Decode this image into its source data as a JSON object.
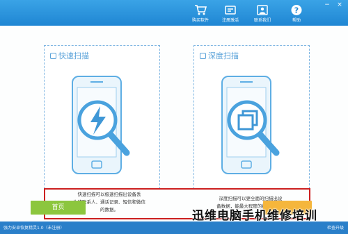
{
  "window": {
    "minimize": "−",
    "close": "×"
  },
  "toolbar": {
    "items": [
      {
        "label": "购买软件",
        "icon": "cart-icon"
      },
      {
        "label": "注册激活",
        "icon": "key-icon"
      },
      {
        "label": "联系我们",
        "icon": "contact-icon"
      },
      {
        "label": "帮助",
        "icon": "help-icon"
      }
    ]
  },
  "panels": {
    "quick": {
      "title": "快速扫描",
      "icon": "lightning-icon",
      "description_line1": "快速扫描可以极速扫描出设备丢",
      "description_line2": "失的联系人、通话记录、短信和微信",
      "description_line3": "的数据。"
    },
    "deep": {
      "title": "深度扫描",
      "icon": "layers-icon",
      "description_line1": "深度扫描可以更全面的扫描出设",
      "description_line2": "备数据，能最大程度的找回文件。"
    }
  },
  "buttons": {
    "home": "首页",
    "next": ""
  },
  "status": {
    "left": "强力安卓恢复精灵1.0（未注册）",
    "right": "检查升级"
  },
  "watermark": "迅维电脑手机维修培训",
  "colors": {
    "accent": "#1f86d3",
    "green": "#8cc63e",
    "orange": "#f5b63c",
    "highlight": "#cc1f1f"
  }
}
